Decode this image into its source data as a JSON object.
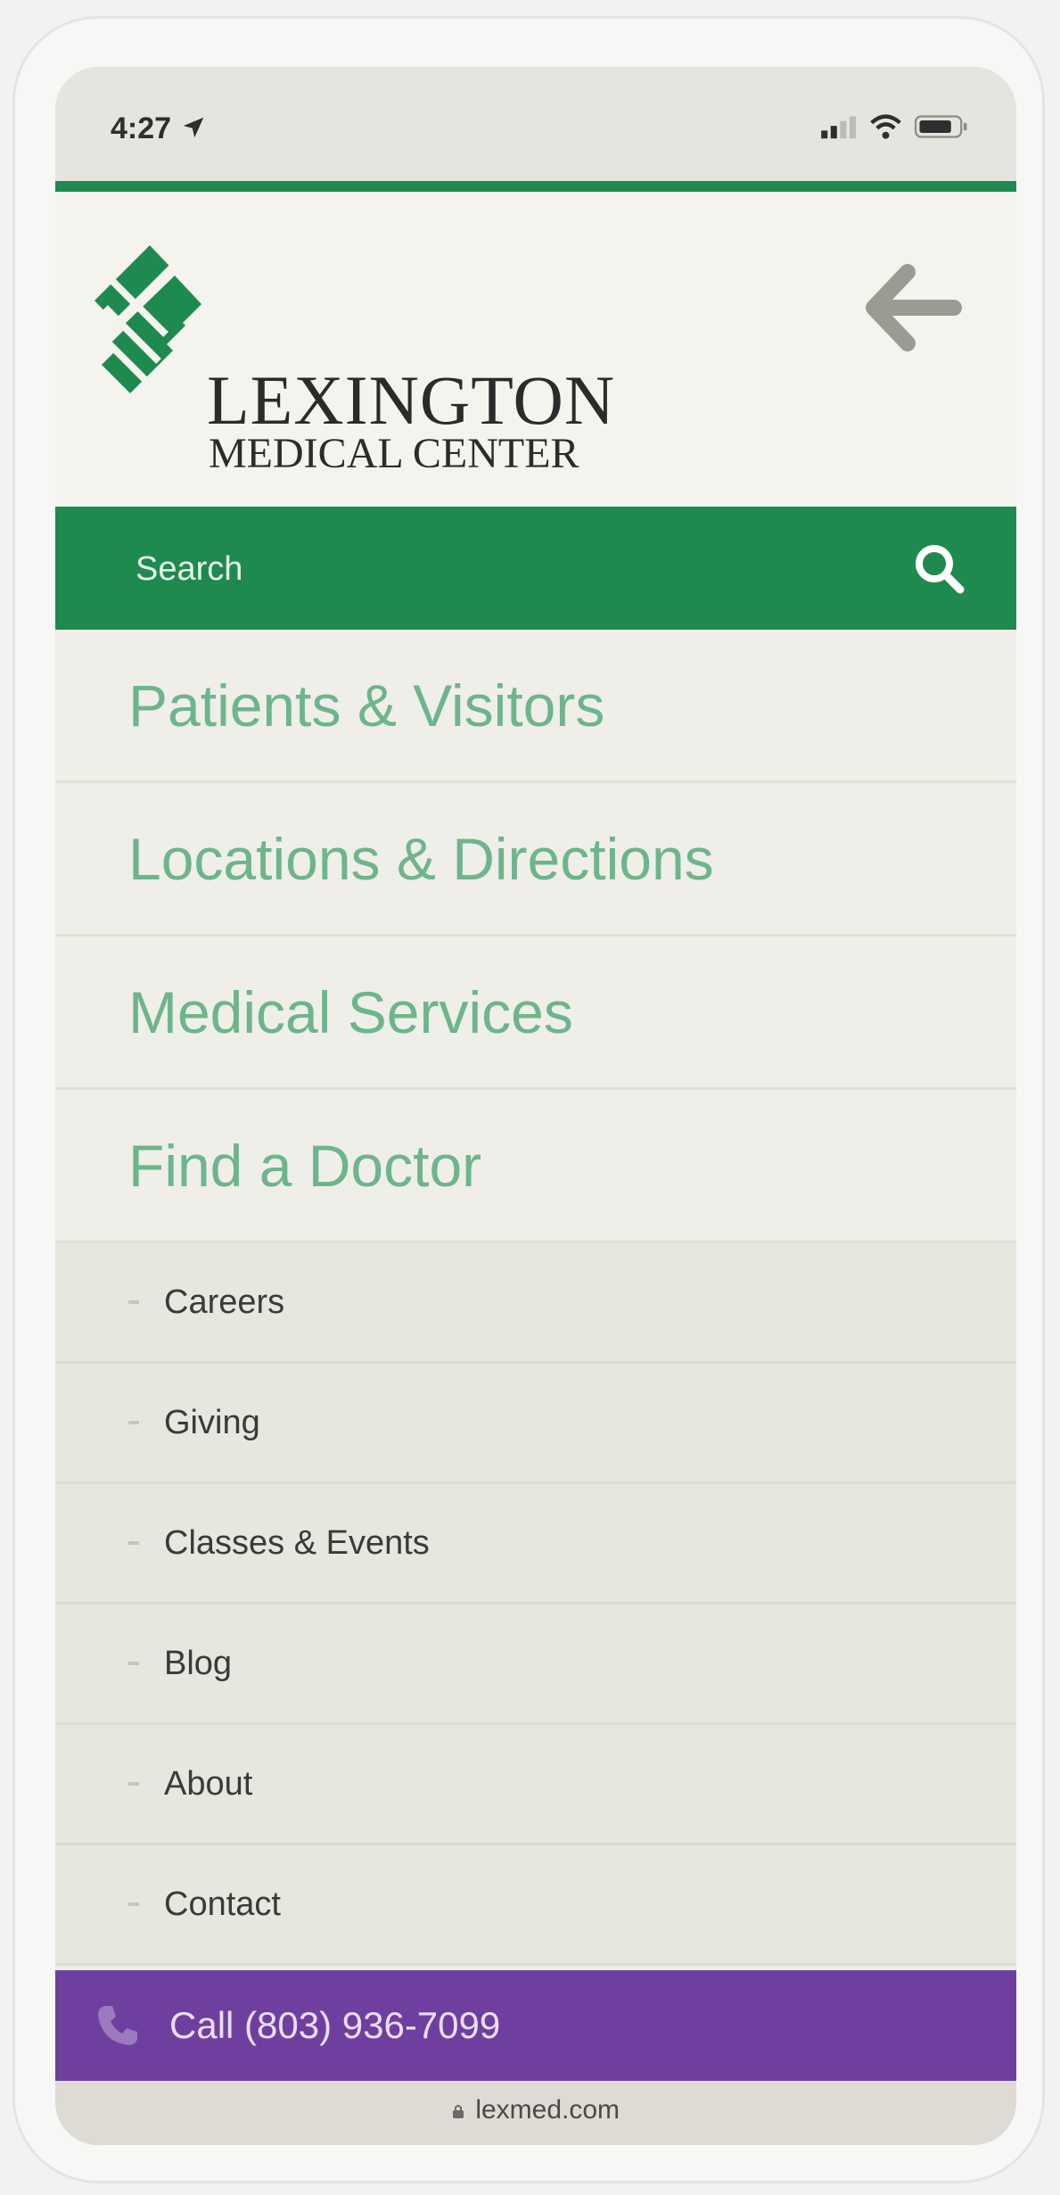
{
  "status_bar": {
    "time": "4:27"
  },
  "header": {
    "logo_line1": "LEXINGTON",
    "logo_line2": "MEDICAL CENTER",
    "logo_color": "#1f8a4f"
  },
  "search": {
    "placeholder": "Search"
  },
  "primary_nav": {
    "items": [
      {
        "label": "Patients & Visitors"
      },
      {
        "label": "Locations & Directions"
      },
      {
        "label": "Medical Services"
      },
      {
        "label": "Find a Doctor"
      }
    ]
  },
  "secondary_nav": {
    "items": [
      {
        "label": "Careers"
      },
      {
        "label": "Giving"
      },
      {
        "label": "Classes & Events"
      },
      {
        "label": "Blog"
      },
      {
        "label": "About"
      },
      {
        "label": "Contact"
      }
    ]
  },
  "call": {
    "label": "Call (803) 936-7099"
  },
  "browser": {
    "url": "lexmed.com"
  },
  "colors": {
    "brand_green": "#1f8a4f",
    "nav_text_green": "#6db58a",
    "call_purple": "#6f3fa0"
  },
  "icons": {
    "search": "search-icon",
    "back": "back-arrow-icon",
    "phone": "phone-icon",
    "location": "location-arrow-icon",
    "signal": "signal-icon",
    "wifi": "wifi-icon",
    "battery": "battery-icon",
    "lock": "lock-icon"
  }
}
